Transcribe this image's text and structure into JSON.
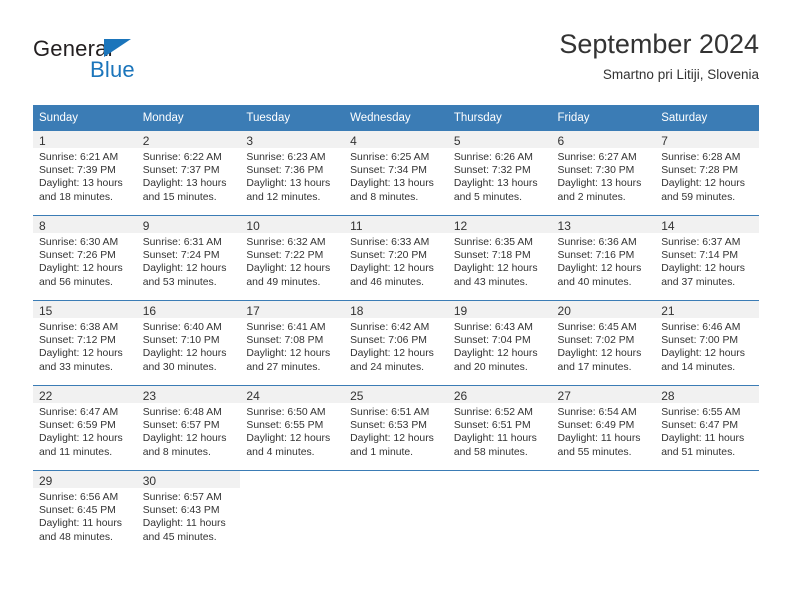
{
  "brand": {
    "name_part1": "General",
    "name_part2": "Blue",
    "triangle_color": "#1b75bb"
  },
  "header": {
    "title": "September 2024",
    "subtitle": "Smartno pri Litiji, Slovenia",
    "header_bg": "#3b7cb5",
    "header_text_color": "#ffffff"
  },
  "weekdays": [
    "Sunday",
    "Monday",
    "Tuesday",
    "Wednesday",
    "Thursday",
    "Friday",
    "Saturday"
  ],
  "labels": {
    "sunrise_prefix": "Sunrise:",
    "sunset_prefix": "Sunset:",
    "daylight_prefix": "Daylight:"
  },
  "weeks": [
    [
      {
        "day": "1",
        "sunrise": "Sunrise: 6:21 AM",
        "sunset": "Sunset: 7:39 PM",
        "daylight_l1": "Daylight: 13 hours",
        "daylight_l2": "and 18 minutes."
      },
      {
        "day": "2",
        "sunrise": "Sunrise: 6:22 AM",
        "sunset": "Sunset: 7:37 PM",
        "daylight_l1": "Daylight: 13 hours",
        "daylight_l2": "and 15 minutes."
      },
      {
        "day": "3",
        "sunrise": "Sunrise: 6:23 AM",
        "sunset": "Sunset: 7:36 PM",
        "daylight_l1": "Daylight: 13 hours",
        "daylight_l2": "and 12 minutes."
      },
      {
        "day": "4",
        "sunrise": "Sunrise: 6:25 AM",
        "sunset": "Sunset: 7:34 PM",
        "daylight_l1": "Daylight: 13 hours",
        "daylight_l2": "and 8 minutes."
      },
      {
        "day": "5",
        "sunrise": "Sunrise: 6:26 AM",
        "sunset": "Sunset: 7:32 PM",
        "daylight_l1": "Daylight: 13 hours",
        "daylight_l2": "and 5 minutes."
      },
      {
        "day": "6",
        "sunrise": "Sunrise: 6:27 AM",
        "sunset": "Sunset: 7:30 PM",
        "daylight_l1": "Daylight: 13 hours",
        "daylight_l2": "and 2 minutes."
      },
      {
        "day": "7",
        "sunrise": "Sunrise: 6:28 AM",
        "sunset": "Sunset: 7:28 PM",
        "daylight_l1": "Daylight: 12 hours",
        "daylight_l2": "and 59 minutes."
      }
    ],
    [
      {
        "day": "8",
        "sunrise": "Sunrise: 6:30 AM",
        "sunset": "Sunset: 7:26 PM",
        "daylight_l1": "Daylight: 12 hours",
        "daylight_l2": "and 56 minutes."
      },
      {
        "day": "9",
        "sunrise": "Sunrise: 6:31 AM",
        "sunset": "Sunset: 7:24 PM",
        "daylight_l1": "Daylight: 12 hours",
        "daylight_l2": "and 53 minutes."
      },
      {
        "day": "10",
        "sunrise": "Sunrise: 6:32 AM",
        "sunset": "Sunset: 7:22 PM",
        "daylight_l1": "Daylight: 12 hours",
        "daylight_l2": "and 49 minutes."
      },
      {
        "day": "11",
        "sunrise": "Sunrise: 6:33 AM",
        "sunset": "Sunset: 7:20 PM",
        "daylight_l1": "Daylight: 12 hours",
        "daylight_l2": "and 46 minutes."
      },
      {
        "day": "12",
        "sunrise": "Sunrise: 6:35 AM",
        "sunset": "Sunset: 7:18 PM",
        "daylight_l1": "Daylight: 12 hours",
        "daylight_l2": "and 43 minutes."
      },
      {
        "day": "13",
        "sunrise": "Sunrise: 6:36 AM",
        "sunset": "Sunset: 7:16 PM",
        "daylight_l1": "Daylight: 12 hours",
        "daylight_l2": "and 40 minutes."
      },
      {
        "day": "14",
        "sunrise": "Sunrise: 6:37 AM",
        "sunset": "Sunset: 7:14 PM",
        "daylight_l1": "Daylight: 12 hours",
        "daylight_l2": "and 37 minutes."
      }
    ],
    [
      {
        "day": "15",
        "sunrise": "Sunrise: 6:38 AM",
        "sunset": "Sunset: 7:12 PM",
        "daylight_l1": "Daylight: 12 hours",
        "daylight_l2": "and 33 minutes."
      },
      {
        "day": "16",
        "sunrise": "Sunrise: 6:40 AM",
        "sunset": "Sunset: 7:10 PM",
        "daylight_l1": "Daylight: 12 hours",
        "daylight_l2": "and 30 minutes."
      },
      {
        "day": "17",
        "sunrise": "Sunrise: 6:41 AM",
        "sunset": "Sunset: 7:08 PM",
        "daylight_l1": "Daylight: 12 hours",
        "daylight_l2": "and 27 minutes."
      },
      {
        "day": "18",
        "sunrise": "Sunrise: 6:42 AM",
        "sunset": "Sunset: 7:06 PM",
        "daylight_l1": "Daylight: 12 hours",
        "daylight_l2": "and 24 minutes."
      },
      {
        "day": "19",
        "sunrise": "Sunrise: 6:43 AM",
        "sunset": "Sunset: 7:04 PM",
        "daylight_l1": "Daylight: 12 hours",
        "daylight_l2": "and 20 minutes."
      },
      {
        "day": "20",
        "sunrise": "Sunrise: 6:45 AM",
        "sunset": "Sunset: 7:02 PM",
        "daylight_l1": "Daylight: 12 hours",
        "daylight_l2": "and 17 minutes."
      },
      {
        "day": "21",
        "sunrise": "Sunrise: 6:46 AM",
        "sunset": "Sunset: 7:00 PM",
        "daylight_l1": "Daylight: 12 hours",
        "daylight_l2": "and 14 minutes."
      }
    ],
    [
      {
        "day": "22",
        "sunrise": "Sunrise: 6:47 AM",
        "sunset": "Sunset: 6:59 PM",
        "daylight_l1": "Daylight: 12 hours",
        "daylight_l2": "and 11 minutes."
      },
      {
        "day": "23",
        "sunrise": "Sunrise: 6:48 AM",
        "sunset": "Sunset: 6:57 PM",
        "daylight_l1": "Daylight: 12 hours",
        "daylight_l2": "and 8 minutes."
      },
      {
        "day": "24",
        "sunrise": "Sunrise: 6:50 AM",
        "sunset": "Sunset: 6:55 PM",
        "daylight_l1": "Daylight: 12 hours",
        "daylight_l2": "and 4 minutes."
      },
      {
        "day": "25",
        "sunrise": "Sunrise: 6:51 AM",
        "sunset": "Sunset: 6:53 PM",
        "daylight_l1": "Daylight: 12 hours",
        "daylight_l2": "and 1 minute."
      },
      {
        "day": "26",
        "sunrise": "Sunrise: 6:52 AM",
        "sunset": "Sunset: 6:51 PM",
        "daylight_l1": "Daylight: 11 hours",
        "daylight_l2": "and 58 minutes."
      },
      {
        "day": "27",
        "sunrise": "Sunrise: 6:54 AM",
        "sunset": "Sunset: 6:49 PM",
        "daylight_l1": "Daylight: 11 hours",
        "daylight_l2": "and 55 minutes."
      },
      {
        "day": "28",
        "sunrise": "Sunrise: 6:55 AM",
        "sunset": "Sunset: 6:47 PM",
        "daylight_l1": "Daylight: 11 hours",
        "daylight_l2": "and 51 minutes."
      }
    ],
    [
      {
        "day": "29",
        "sunrise": "Sunrise: 6:56 AM",
        "sunset": "Sunset: 6:45 PM",
        "daylight_l1": "Daylight: 11 hours",
        "daylight_l2": "and 48 minutes."
      },
      {
        "day": "30",
        "sunrise": "Sunrise: 6:57 AM",
        "sunset": "Sunset: 6:43 PM",
        "daylight_l1": "Daylight: 11 hours",
        "daylight_l2": "and 45 minutes."
      },
      {
        "day": "",
        "sunrise": "",
        "sunset": "",
        "daylight_l1": "",
        "daylight_l2": ""
      },
      {
        "day": "",
        "sunrise": "",
        "sunset": "",
        "daylight_l1": "",
        "daylight_l2": ""
      },
      {
        "day": "",
        "sunrise": "",
        "sunset": "",
        "daylight_l1": "",
        "daylight_l2": ""
      },
      {
        "day": "",
        "sunrise": "",
        "sunset": "",
        "daylight_l1": "",
        "daylight_l2": ""
      },
      {
        "day": "",
        "sunrise": "",
        "sunset": "",
        "daylight_l1": "",
        "daylight_l2": ""
      }
    ]
  ]
}
